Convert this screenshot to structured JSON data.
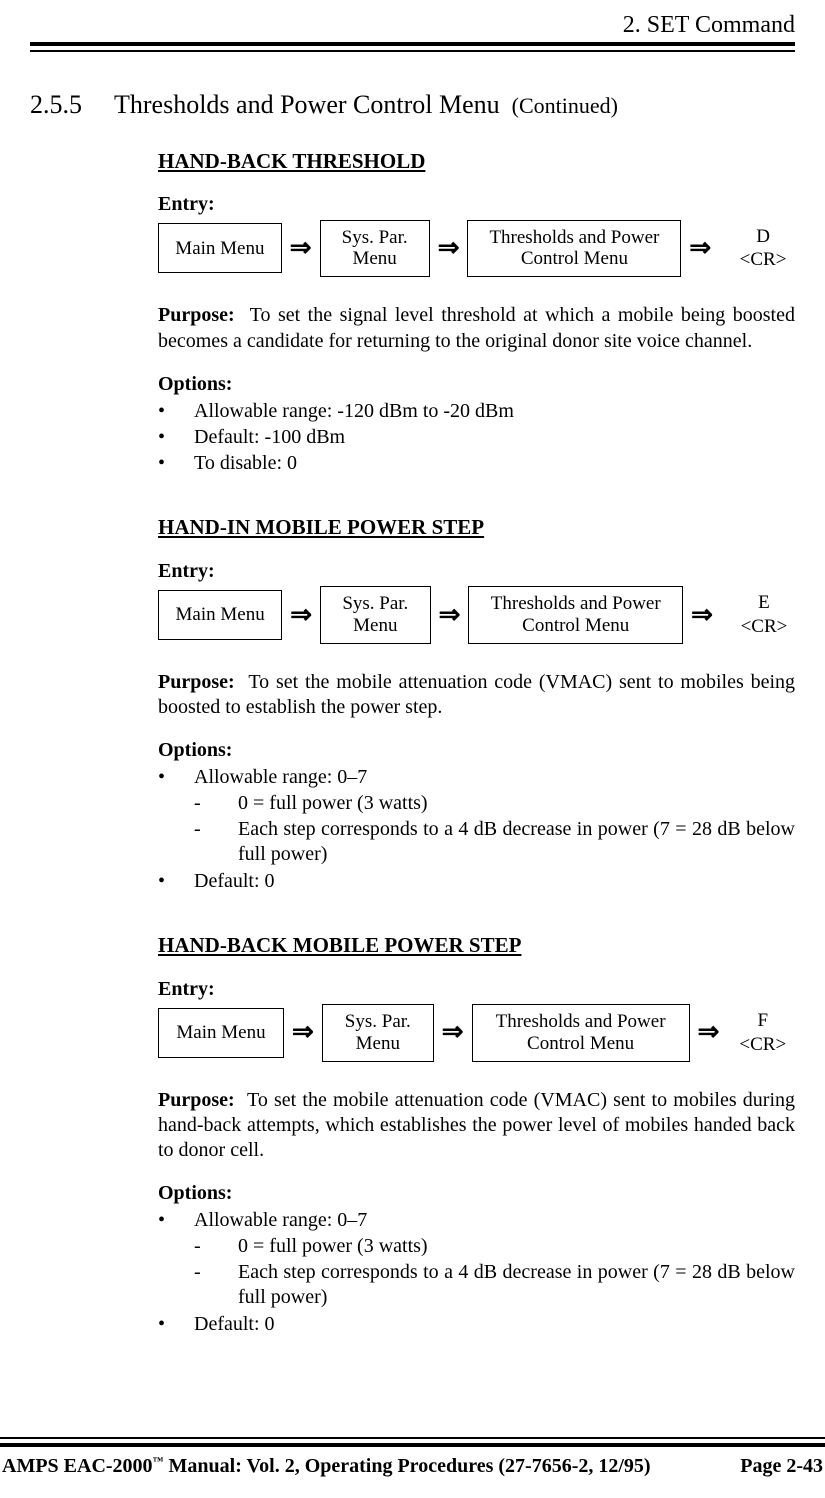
{
  "header": "2.  SET Command",
  "section": {
    "number": "2.5.5",
    "title": "Thresholds and Power Control Menu",
    "continued": "(Continued)"
  },
  "nav": {
    "box1": "Main Menu",
    "box2": "Sys. Par.\nMenu",
    "box3": "Thresholds and Power\nControl Menu",
    "arrow": "⇒"
  },
  "labels": {
    "entry": "Entry:",
    "purpose": "Purpose:",
    "options": "Options:"
  },
  "params": [
    {
      "title": "HAND-BACK THRESHOLD",
      "cmd": "D <CR>",
      "purpose": "To set the signal level threshold at which a mobile being boosted becomes a candidate for returning to the original donor site voice channel.",
      "options": [
        {
          "text": "Allowable range:  -120 dBm to -20 dBm"
        },
        {
          "text": "Default:  -100 dBm"
        },
        {
          "text": "To disable:  0"
        }
      ]
    },
    {
      "title": "HAND-IN MOBILE POWER STEP",
      "cmd": "E <CR>",
      "purpose": "To set the mobile attenuation code (VMAC) sent to mobiles being boosted to establish the power step.",
      "options": [
        {
          "text": "Allowable range:  0–7",
          "sub": [
            "0 = full power (3 watts)",
            "Each step corresponds to a 4 dB decrease in power (7 = 28 dB below full power)"
          ]
        },
        {
          "text": "Default:  0"
        }
      ]
    },
    {
      "title": "HAND-BACK MOBILE POWER STEP",
      "cmd": "F\n<CR>",
      "purpose": "To set the mobile attenuation code (VMAC) sent to mobiles during hand-back attempts, which establishes the power level of mobiles handed back to donor cell.",
      "options": [
        {
          "text": "Allowable range:   0–7",
          "sub": [
            "0 = full power (3 watts)",
            "Each step corresponds to a 4 dB decrease in power (7 = 28 dB below full power)"
          ]
        },
        {
          "text": "Default:  0"
        }
      ]
    }
  ],
  "footer": {
    "left_pre": "AMPS EAC-2000",
    "tm": "™",
    "left_post": " Manual:  Vol. 2, Operating Procedures (27-7656-2, 12/95)",
    "right": "Page 2-43"
  }
}
